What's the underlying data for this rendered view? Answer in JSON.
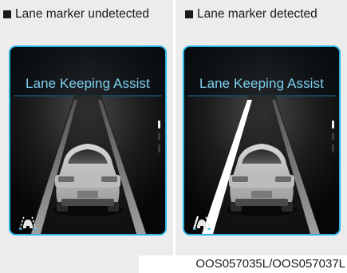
{
  "panels": [
    {
      "heading": "Lane marker undetected",
      "screen_title": "Lane Keeping Assist",
      "lane_marker_detected": false
    },
    {
      "heading": "Lane marker detected",
      "screen_title": "Lane Keeping Assist",
      "lane_marker_detected": true
    }
  ],
  "caption": "OOS057035L/OOS057037L",
  "colors": {
    "screen_border": "#29b3e3",
    "screen_title": "#7dd3f2",
    "lane_undetected": "#9a9a9a",
    "lane_detected": "#ffffff",
    "icon_wheel_accent": "#29b3e3"
  },
  "icons": {
    "vehicle": "car-rear-view-icon",
    "indicator": "lane-indicator-icon",
    "lka": "lane-keeping-assist-icon"
  }
}
